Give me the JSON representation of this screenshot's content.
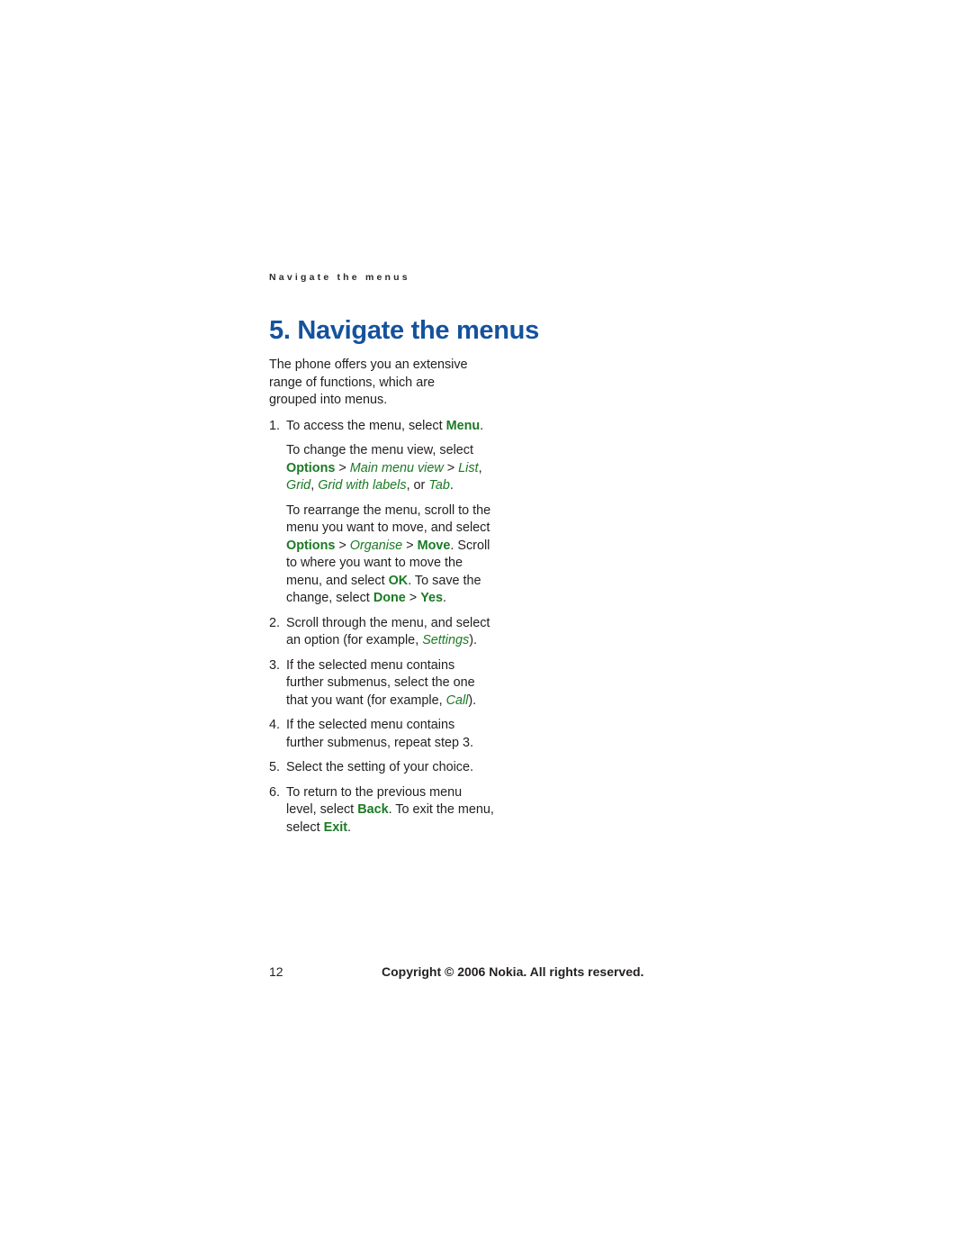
{
  "page": {
    "running_header": "Navigate the menus",
    "chapter_title": "5. Navigate the menus",
    "intro": "The phone offers you an extensive range of functions, which are grouped into menus.",
    "colors": {
      "title_blue": "#15529e",
      "keyword_green": "#1b7a24",
      "body_black": "#231f20",
      "header_gray": "#2b2b2b",
      "background": "#ffffff"
    }
  },
  "steps": [
    {
      "marker": "1.",
      "paragraphs": [
        {
          "runs": [
            {
              "text": "To access the menu, select ",
              "style": "plain"
            },
            {
              "text": "Menu",
              "style": "bold-green"
            },
            {
              "text": ".",
              "style": "plain"
            }
          ]
        },
        {
          "runs": [
            {
              "text": "To change the menu view, select ",
              "style": "plain"
            },
            {
              "text": "Options",
              "style": "bold-green"
            },
            {
              "text": " > ",
              "style": "plain"
            },
            {
              "text": "Main menu view",
              "style": "italic-green"
            },
            {
              "text": " > ",
              "style": "plain"
            },
            {
              "text": "List",
              "style": "italic-green"
            },
            {
              "text": ", ",
              "style": "plain"
            },
            {
              "text": "Grid",
              "style": "italic-green"
            },
            {
              "text": ", ",
              "style": "plain"
            },
            {
              "text": "Grid with labels",
              "style": "italic-green"
            },
            {
              "text": ", or ",
              "style": "plain"
            },
            {
              "text": "Tab",
              "style": "italic-green"
            },
            {
              "text": ".",
              "style": "plain"
            }
          ]
        },
        {
          "runs": [
            {
              "text": "To rearrange the menu, scroll to the menu you want to move, and select ",
              "style": "plain"
            },
            {
              "text": "Options",
              "style": "bold-green"
            },
            {
              "text": " > ",
              "style": "plain"
            },
            {
              "text": "Organise",
              "style": "italic-green"
            },
            {
              "text": " > ",
              "style": "plain"
            },
            {
              "text": "Move",
              "style": "bold-green"
            },
            {
              "text": ". Scroll to where you want to move the menu, and select ",
              "style": "plain"
            },
            {
              "text": "OK",
              "style": "bold-green"
            },
            {
              "text": ". To save the change, select ",
              "style": "plain"
            },
            {
              "text": "Done",
              "style": "bold-green"
            },
            {
              "text": " > ",
              "style": "plain"
            },
            {
              "text": "Yes",
              "style": "bold-green"
            },
            {
              "text": ".",
              "style": "plain"
            }
          ]
        }
      ]
    },
    {
      "marker": "2.",
      "paragraphs": [
        {
          "runs": [
            {
              "text": "Scroll through the menu, and select an option (for example, ",
              "style": "plain"
            },
            {
              "text": "Settings",
              "style": "italic-green"
            },
            {
              "text": ").",
              "style": "plain"
            }
          ]
        }
      ]
    },
    {
      "marker": "3.",
      "paragraphs": [
        {
          "runs": [
            {
              "text": "If the selected menu contains further submenus, select the one that you want (for example, ",
              "style": "plain"
            },
            {
              "text": "Call",
              "style": "italic-green"
            },
            {
              "text": ").",
              "style": "plain"
            }
          ]
        }
      ]
    },
    {
      "marker": "4.",
      "paragraphs": [
        {
          "runs": [
            {
              "text": "If the selected menu contains further submenus, repeat step 3.",
              "style": "plain"
            }
          ]
        }
      ]
    },
    {
      "marker": "5.",
      "paragraphs": [
        {
          "runs": [
            {
              "text": "Select the setting of your choice.",
              "style": "plain"
            }
          ]
        }
      ]
    },
    {
      "marker": "6.",
      "paragraphs": [
        {
          "runs": [
            {
              "text": "To return to the previous menu level, select ",
              "style": "plain"
            },
            {
              "text": "Back",
              "style": "bold-green"
            },
            {
              "text": ". To exit the menu, select ",
              "style": "plain"
            },
            {
              "text": "Exit",
              "style": "bold-green"
            },
            {
              "text": ".",
              "style": "plain"
            }
          ]
        }
      ]
    }
  ],
  "footer": {
    "page_number": "12",
    "copyright": "Copyright © 2006 Nokia. All rights reserved."
  }
}
